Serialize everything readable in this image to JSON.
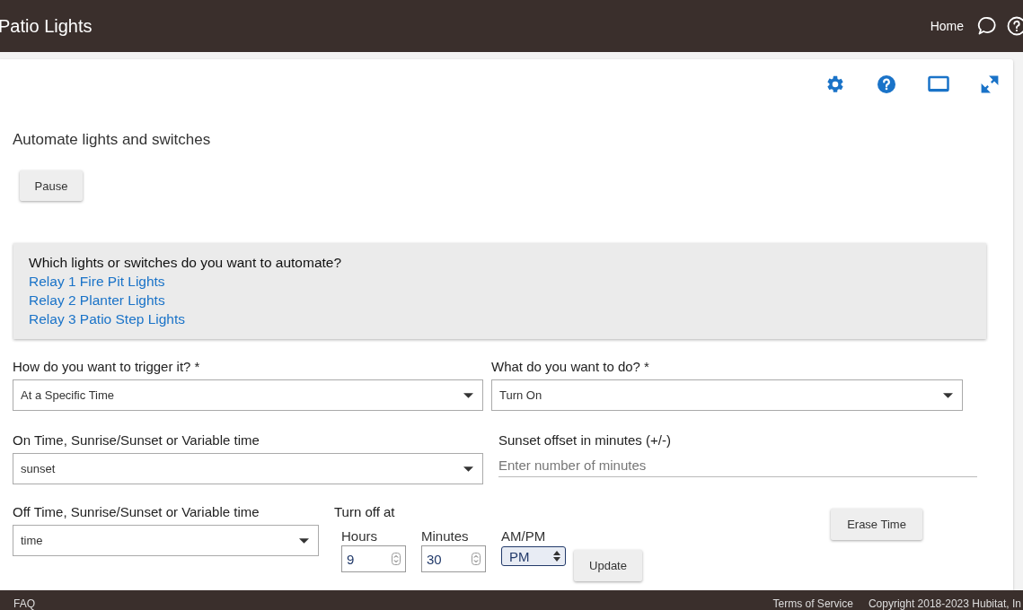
{
  "header": {
    "title": "Patio Lights",
    "links": [
      "Home"
    ]
  },
  "app": {
    "heading": "Automate lights and switches",
    "pause_button": "Pause",
    "devices": {
      "question": "Which lights or switches do you want to automate?",
      "items": [
        "Relay 1 Fire Pit Lights",
        "Relay 2 Planter Lights",
        "Relay 3 Patio Step Lights"
      ]
    },
    "trigger": {
      "label": "How do you want to trigger it? *",
      "value": "At a Specific Time"
    },
    "action": {
      "label": "What do you want to do? *",
      "value": "Turn On"
    },
    "on_time": {
      "label": "On Time, Sunrise/Sunset or Variable time",
      "value": "sunset"
    },
    "offset": {
      "label": "Sunset offset in minutes (+/-)",
      "placeholder": "Enter number of minutes"
    },
    "off_time": {
      "label": "Off Time, Sunrise/Sunset or Variable time",
      "value": "time"
    },
    "turn_off": {
      "label": "Turn off at",
      "hours_label": "Hours",
      "hours": "9",
      "minutes_label": "Minutes",
      "minutes": "30",
      "ampm_label": "AM/PM",
      "ampm": "PM",
      "update_button": "Update"
    },
    "erase_button": "Erase Time"
  },
  "footer": {
    "left": "FAQ",
    "links": [
      "Terms of Service"
    ],
    "copyright": "Copyright 2018-2023 Hubitat, In"
  }
}
